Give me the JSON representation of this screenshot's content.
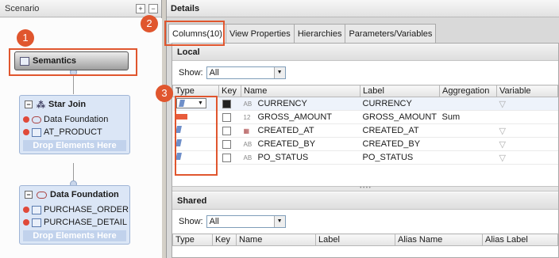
{
  "scenario": {
    "title": "Scenario",
    "semantics_label": "Semantics",
    "star_join": {
      "title": "Star Join",
      "items": [
        "Data Foundation",
        "AT_PRODUCT"
      ],
      "drop_label": "Drop Elements Here"
    },
    "data_foundation": {
      "title": "Data Foundation",
      "items": [
        "PURCHASE_ORDER",
        "PURCHASE_DETAIL"
      ],
      "drop_label": "Drop Elements Here"
    }
  },
  "details": {
    "title": "Details",
    "tabs": [
      "Columns(10)",
      "View Properties",
      "Hierarchies",
      "Parameters/Variables"
    ],
    "local": {
      "title": "Local",
      "show_label": "Show:",
      "show_value": "All",
      "columns": [
        "Type",
        "Key",
        "Name",
        "Label",
        "Aggregation",
        "Variable"
      ],
      "rows": [
        {
          "dtype": "AB",
          "name": "CURRENCY",
          "label": "CURRENCY",
          "aggregation": "",
          "variable_icon": "filter-icon"
        },
        {
          "dtype": "12",
          "name": "GROSS_AMOUNT",
          "label": "GROSS_AMOUNT",
          "aggregation": "Sum",
          "variable_icon": ""
        },
        {
          "dtype": "date",
          "name": "CREATED_AT",
          "label": "CREATED_AT",
          "aggregation": "",
          "variable_icon": "filter-icon"
        },
        {
          "dtype": "AB",
          "name": "CREATED_BY",
          "label": "CREATED_BY",
          "aggregation": "",
          "variable_icon": "filter-icon"
        },
        {
          "dtype": "AB",
          "name": "PO_STATUS",
          "label": "PO_STATUS",
          "aggregation": "",
          "variable_icon": "filter-icon"
        }
      ]
    },
    "shared": {
      "title": "Shared",
      "show_label": "Show:",
      "show_value": "All",
      "columns": [
        "Type",
        "Key",
        "Name",
        "Label",
        "Alias Name",
        "Alias Label"
      ]
    }
  },
  "callouts": [
    "1",
    "2",
    "3"
  ],
  "colors": {
    "callout": "#e0562e",
    "measure": "#e85b3b",
    "attribute": "#6f8fc9"
  }
}
